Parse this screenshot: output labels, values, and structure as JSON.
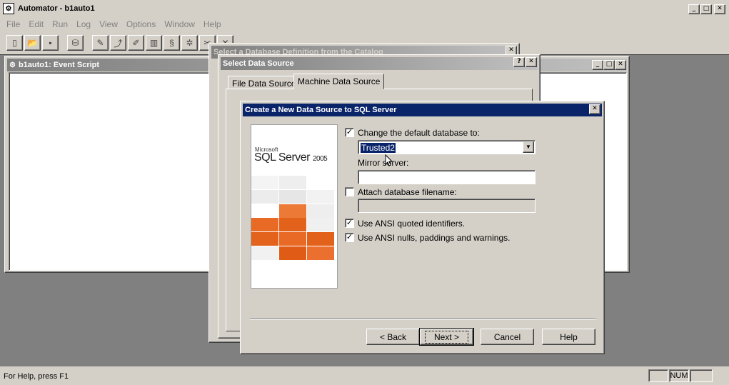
{
  "app": {
    "title": "Automator - b1auto1"
  },
  "menu": [
    "File",
    "Edit",
    "Run",
    "Log",
    "View",
    "Options",
    "Window",
    "Help"
  ],
  "toolbar": [
    "new-icon",
    "open-icon",
    "save-icon",
    "database-icon",
    "script-icon",
    "run-icon",
    "edit-icon",
    "chart-icon",
    "step-icon",
    "debug-icon",
    "tools-icon",
    "close-icon",
    "grid-icon",
    "list-icon",
    "arrow-icon",
    "table-icon",
    "chart-icon",
    "link-icon",
    "help-icon"
  ],
  "script_window": {
    "title": "b1auto1: Event Script"
  },
  "catalog_dialog": {
    "title": "Select a Database Definition from the Catalog"
  },
  "select_dialog": {
    "title": "Select Data Source",
    "tabs": [
      "File Data Source",
      "Machine Data Source"
    ]
  },
  "create_dialog": {
    "title": "Create a New Data Source to SQL Server",
    "logo": {
      "brand": "Microsoft",
      "product": "SQL Server",
      "version": "2005"
    },
    "change_db_label": "Change the default database to:",
    "change_db_checked": true,
    "db_value": "Trusted2",
    "mirror_label": "Mirror server:",
    "mirror_value": "",
    "attach_label": "Attach database filename:",
    "attach_checked": false,
    "ansi_quoted_label": "Use ANSI quoted identifiers.",
    "ansi_quoted_checked": true,
    "ansi_nulls_label": "Use ANSI nulls, paddings and warnings.",
    "ansi_nulls_checked": true,
    "buttons": {
      "back": "< Back",
      "next": "Next >",
      "cancel": "Cancel",
      "help": "Help"
    }
  },
  "status": {
    "text": "For Help, press F1",
    "num": "NUM"
  },
  "colors": {
    "title_active": "#0a246a",
    "sql_orange": "#e8621a",
    "face": "#d4d0c8"
  }
}
